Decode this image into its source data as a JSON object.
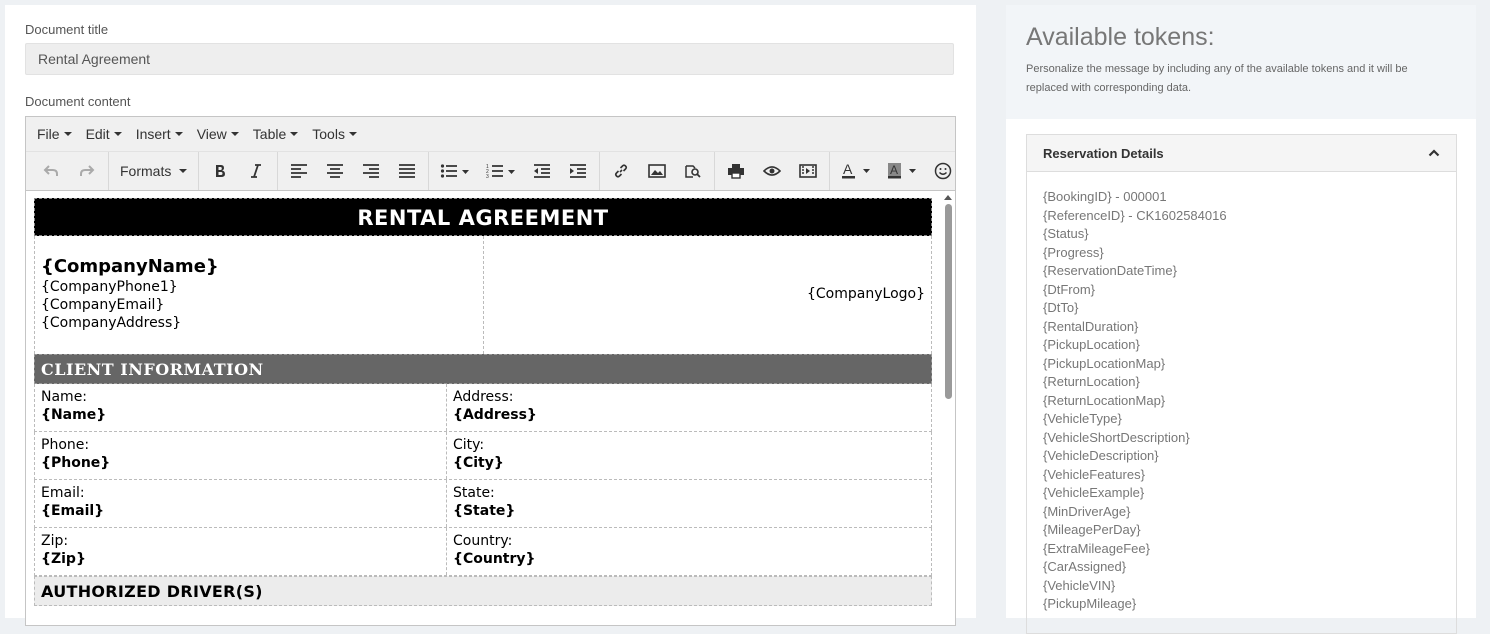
{
  "form": {
    "title_label": "Document title",
    "title_value": "Rental Agreement",
    "content_label": "Document content"
  },
  "editor": {
    "menus": [
      "File",
      "Edit",
      "Insert",
      "View",
      "Table",
      "Tools"
    ],
    "formats_label": "Formats",
    "toolbar_icons": [
      "undo-icon",
      "redo-icon",
      "bold-icon",
      "italic-icon",
      "align-left-icon",
      "align-center-icon",
      "align-right-icon",
      "justify-icon",
      "bullet-list-icon",
      "numbered-list-icon",
      "outdent-icon",
      "indent-icon",
      "link-icon",
      "image-icon",
      "search-icon",
      "print-icon",
      "preview-icon",
      "media-icon",
      "text-color-icon",
      "background-color-icon",
      "emoji-icon"
    ]
  },
  "document": {
    "banner": "RENTAL AGREEMENT",
    "company": {
      "name": "{CompanyName}",
      "phone": "{CompanyPhone1}",
      "email": "{CompanyEmail}",
      "address": "{CompanyAddress}",
      "logo": "{CompanyLogo}"
    },
    "client_header": "CLIENT INFORMATION",
    "client_rows": [
      {
        "l_label": "Name:",
        "l_value": "{Name}",
        "r_label": "Address:",
        "r_value": "{Address}"
      },
      {
        "l_label": "Phone:",
        "l_value": "{Phone}",
        "r_label": "City:",
        "r_value": "{City}"
      },
      {
        "l_label": "Email:",
        "l_value": "{Email}",
        "r_label": "State:",
        "r_value": "{State}"
      },
      {
        "l_label": "Zip:",
        "l_value": "{Zip}",
        "r_label": "Country:",
        "r_value": "{Country}"
      }
    ],
    "drivers_header": "AUTHORIZED DRIVER(S)"
  },
  "tokens": {
    "title": "Available tokens:",
    "description": "Personalize the message by including any of the available tokens and it will be replaced with corresponding data.",
    "section_title": "Reservation Details",
    "items": [
      "{BookingID} - 000001",
      "{ReferenceID} - CK1602584016",
      "{Status}",
      "{Progress}",
      "{ReservationDateTime}",
      "{DtFrom}",
      "{DtTo}",
      "{RentalDuration}",
      "{PickupLocation}",
      "{PickupLocationMap}",
      "{ReturnLocation}",
      "{ReturnLocationMap}",
      "{VehicleType}",
      "{VehicleShortDescription}",
      "{VehicleDescription}",
      "{VehicleFeatures}",
      "{VehicleExample}",
      "{MinDriverAge}",
      "{MileagePerDay}",
      "{ExtraMileageFee}",
      "{CarAssigned}",
      "{VehicleVIN}",
      "{PickupMileage}"
    ]
  },
  "colors": {
    "banner_bg": "#000000",
    "section_dark_bg": "#666666",
    "section_light_bg": "#ececec",
    "page_bg": "#eef1f4"
  }
}
